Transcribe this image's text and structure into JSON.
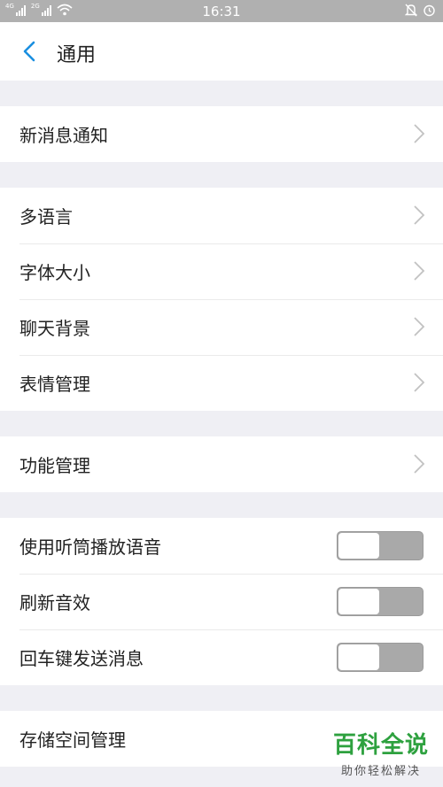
{
  "status_bar": {
    "net1": "4G",
    "net2": "2G",
    "time": "16:31",
    "icons": [
      "signal-icon",
      "wifi-icon",
      "bell-icon",
      "alarm-icon"
    ]
  },
  "header": {
    "title": "通用",
    "back_icon": "chevron-left-icon",
    "accent_color": "#1a8fe0"
  },
  "groups": [
    {
      "items": [
        {
          "label": "新消息通知"
        }
      ]
    },
    {
      "items": [
        {
          "label": "多语言"
        },
        {
          "label": "字体大小"
        },
        {
          "label": "聊天背景"
        },
        {
          "label": "表情管理"
        }
      ]
    },
    {
      "items": [
        {
          "label": "功能管理"
        }
      ]
    },
    {
      "items": [
        {
          "label": "使用听筒播放语音",
          "toggle": false
        },
        {
          "label": "刷新音效",
          "toggle": false
        },
        {
          "label": "回车键发送消息",
          "toggle": false
        }
      ]
    },
    {
      "items": [
        {
          "label": "存储空间管理"
        }
      ]
    }
  ],
  "watermark": {
    "main": "百科全说",
    "sub": "助你轻松解决"
  }
}
